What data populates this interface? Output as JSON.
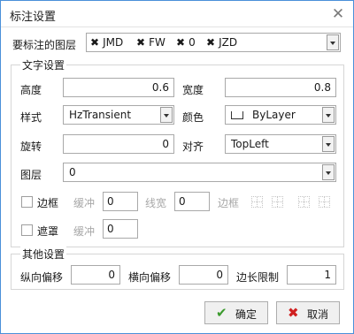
{
  "window": {
    "title": "标注设置",
    "close_glyph": "✕"
  },
  "layers": {
    "label": "要标注的图层",
    "tags": [
      "JMD",
      "FW",
      "0",
      "JZD"
    ],
    "remove_glyph": "✖"
  },
  "text_settings": {
    "legend": "文字设置",
    "height_label": "高度",
    "height_value": "0.6",
    "width_label": "宽度",
    "width_value": "0.8",
    "style_label": "样式",
    "style_value": "HzTransient",
    "color_label": "颜色",
    "color_value": "ByLayer",
    "rotation_label": "旋转",
    "rotation_value": "0",
    "align_label": "对齐",
    "align_value": "TopLeft",
    "layer_label": "图层",
    "layer_value": "0",
    "border_label": "边框",
    "buffer_label": "缓冲",
    "buffer_value": "0",
    "linewidth_label": "线宽",
    "linewidth_value": "0",
    "border2_label": "边框",
    "mask_label": "遮罩",
    "mask_buffer_label": "缓冲",
    "mask_buffer_value": "0"
  },
  "other_settings": {
    "legend": "其他设置",
    "voffset_label": "纵向偏移",
    "voffset_value": "0",
    "hoffset_label": "横向偏移",
    "hoffset_value": "0",
    "edge_label": "边长限制",
    "edge_value": "1"
  },
  "buttons": {
    "ok_label": "确定",
    "ok_glyph": "✔",
    "cancel_label": "取消",
    "cancel_glyph": "✖"
  },
  "colors": {
    "ok_icon": "#3a9a2c",
    "cancel_icon": "#d02020",
    "border_accent": "#4a90d9"
  }
}
